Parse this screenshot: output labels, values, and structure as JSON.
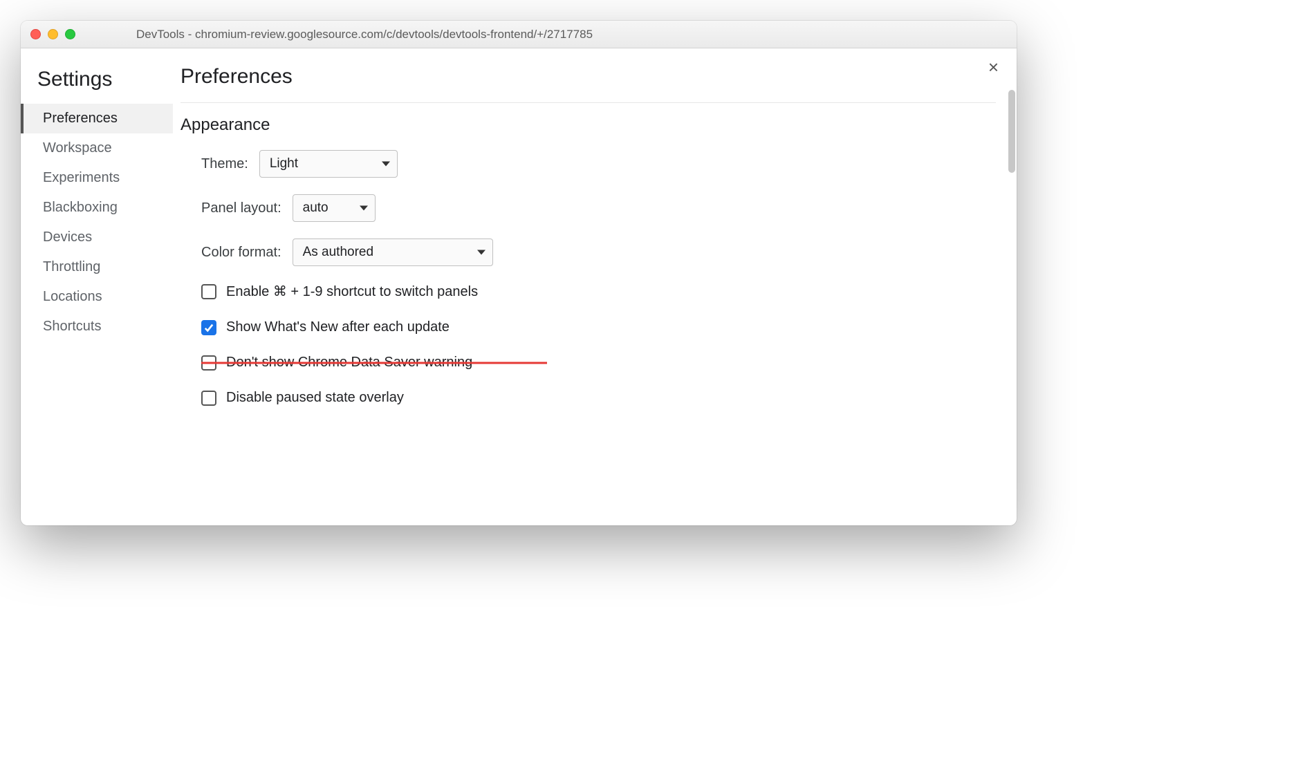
{
  "window": {
    "title": "DevTools - chromium-review.googlesource.com/c/devtools/devtools-frontend/+/2717785"
  },
  "sidebar": {
    "heading": "Settings",
    "items": [
      {
        "label": "Preferences",
        "active": true
      },
      {
        "label": "Workspace"
      },
      {
        "label": "Experiments"
      },
      {
        "label": "Blackboxing"
      },
      {
        "label": "Devices"
      },
      {
        "label": "Throttling"
      },
      {
        "label": "Locations"
      },
      {
        "label": "Shortcuts"
      }
    ]
  },
  "main": {
    "page_title": "Preferences",
    "section_title": "Appearance",
    "theme": {
      "label": "Theme:",
      "value": "Light"
    },
    "panel_layout": {
      "label": "Panel layout:",
      "value": "auto"
    },
    "color_format": {
      "label": "Color format:",
      "value": "As authored"
    },
    "checks": [
      {
        "label": "Enable ⌘ + 1-9 shortcut to switch panels",
        "checked": false,
        "struck": false
      },
      {
        "label": "Show What's New after each update",
        "checked": true,
        "struck": false
      },
      {
        "label": "Don't show Chrome Data Saver warning",
        "checked": false,
        "struck": true
      },
      {
        "label": "Disable paused state overlay",
        "checked": false,
        "struck": false
      }
    ]
  },
  "close_glyph": "×"
}
